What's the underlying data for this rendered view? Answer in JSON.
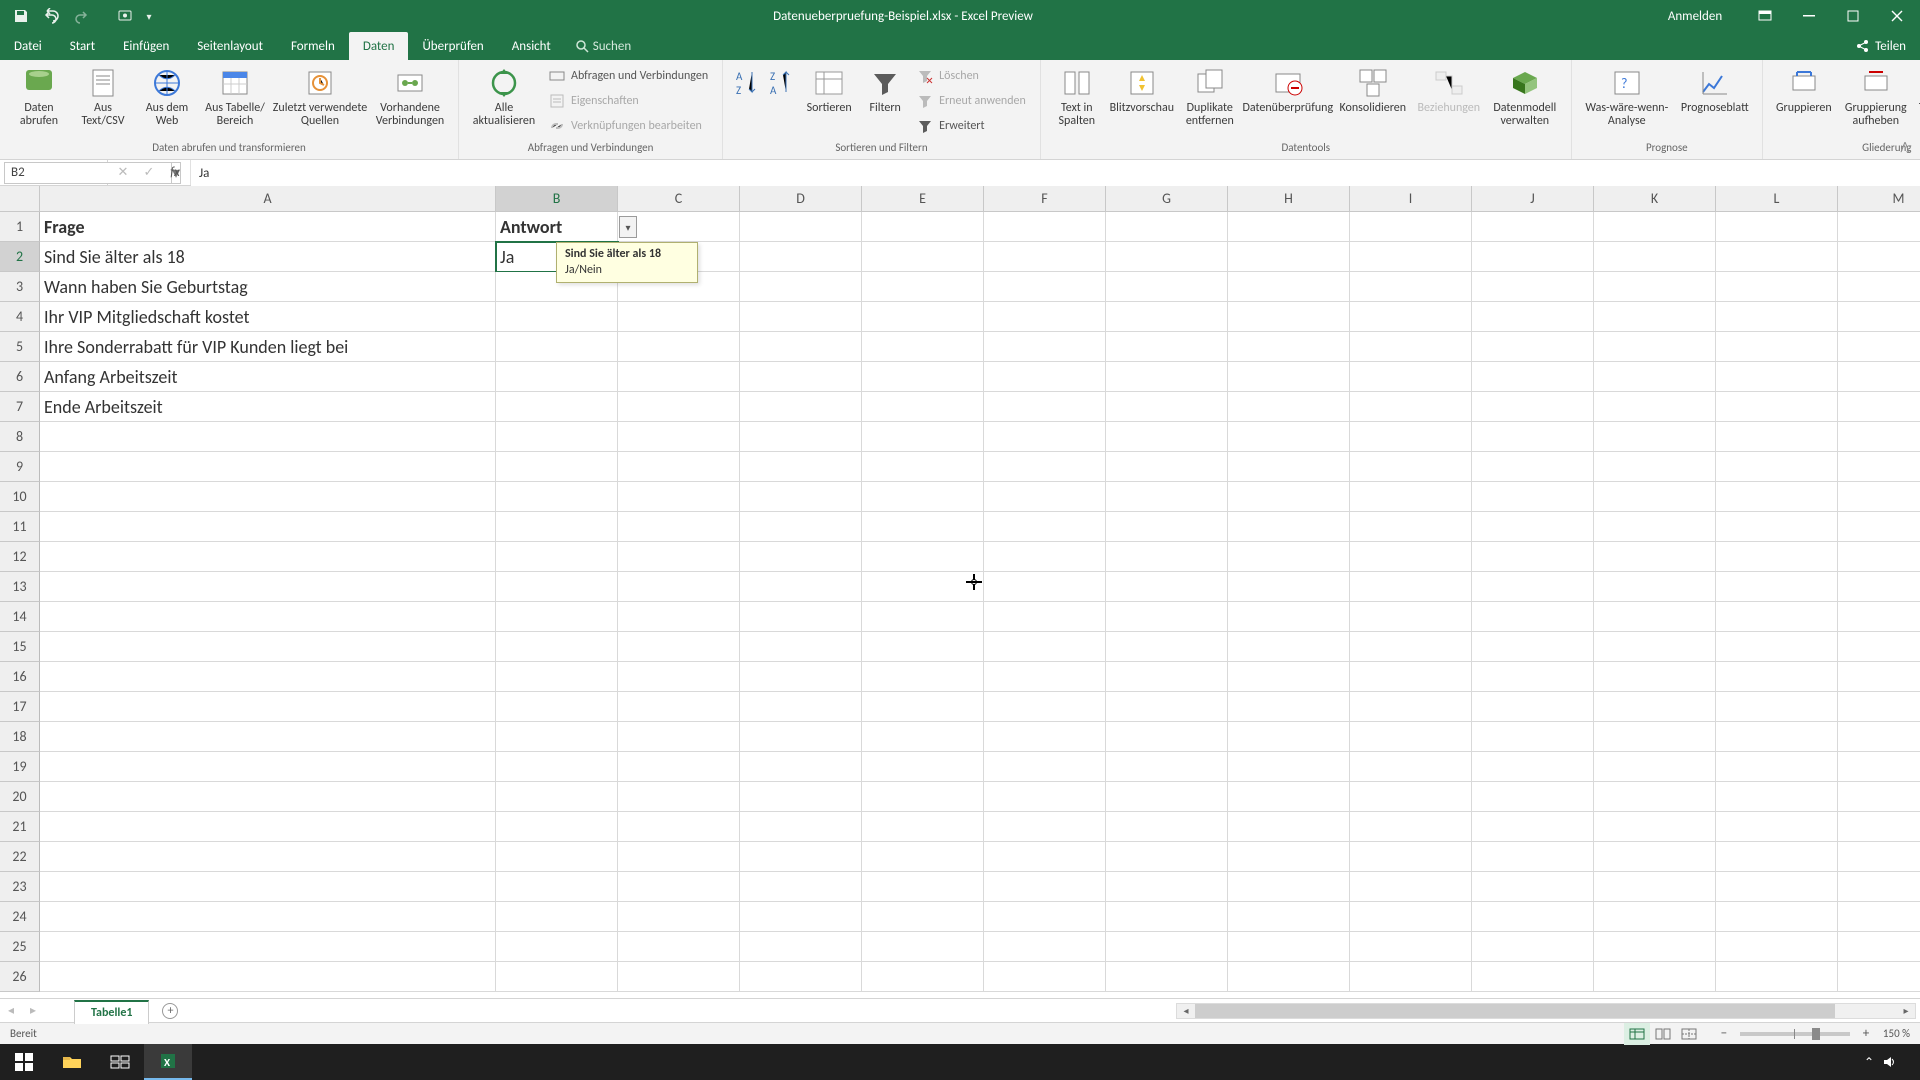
{
  "title_bar": {
    "document_title": "Datenueberpruefung-Beispiel.xlsx - Excel Preview",
    "signin": "Anmelden"
  },
  "ribbon_tabs": {
    "items": [
      "Datei",
      "Start",
      "Einfügen",
      "Seitenlayout",
      "Formeln",
      "Daten",
      "Überprüfen",
      "Ansicht"
    ],
    "active_index": 5,
    "search_placeholder": "Suchen",
    "share_label": "Teilen"
  },
  "ribbon_groups": {
    "get": {
      "label": "Daten abrufen und transformieren",
      "btn_get": "Daten\nabrufen",
      "btn_text": "Aus\nText/CSV",
      "btn_web": "Aus dem\nWeb",
      "btn_tr": "Aus Tabelle/\nBereich",
      "btn_recent": "Zuletzt verwendete\nQuellen",
      "btn_exist": "Vorhandene\nVerbindungen"
    },
    "conn": {
      "label": "Abfragen und Verbindungen",
      "btn_refresh": "Alle\naktualisieren",
      "s1": "Abfragen und Verbindungen",
      "s2": "Eigenschaften",
      "s3": "Verknüpfungen bearbeiten"
    },
    "sort": {
      "label": "Sortieren und Filtern",
      "btn_sort": "Sortieren",
      "btn_filter": "Filtern",
      "s1": "Löschen",
      "s2": "Erneut anwenden",
      "s3": "Erweitert"
    },
    "tools": {
      "label": "Datentools",
      "b1": "Text in\nSpalten",
      "b2": "Blitzvorschau",
      "b3": "Duplikate\nentfernen",
      "b4": "Datenüberprüfung",
      "b5": "Konsolidieren",
      "b6": "Beziehungen",
      "b7": "Datenmodell\nverwalten"
    },
    "forecast": {
      "label": "Prognose",
      "b1": "Was-wäre-wenn-\nAnalyse",
      "b2": "Prognoseblatt"
    },
    "outline": {
      "label": "Gliederung",
      "b1": "Gruppieren",
      "b2": "Gruppierung\naufheben",
      "b3": "Teilergebnis"
    }
  },
  "formula_bar": {
    "namebox": "B2",
    "content": "Ja"
  },
  "grid": {
    "columns": [
      "A",
      "B",
      "C",
      "D",
      "E",
      "F",
      "G",
      "H",
      "I",
      "J",
      "K",
      "L",
      "M"
    ],
    "last_row": 26,
    "selected": {
      "row": 2,
      "col": "B"
    },
    "rows": [
      {
        "n": 1,
        "A": "Frage",
        "B": "Antwort",
        "bold": true
      },
      {
        "n": 2,
        "A": "Sind Sie älter als 18",
        "B": "Ja"
      },
      {
        "n": 3,
        "A": "Wann haben Sie Geburtstag",
        "B": ""
      },
      {
        "n": 4,
        "A": "Ihr VIP Mitgliedschaft kostet",
        "B": ""
      },
      {
        "n": 5,
        "A": "Ihre Sonderrabatt für VIP Kunden liegt bei",
        "B": ""
      },
      {
        "n": 6,
        "A": "Anfang Arbeitszeit",
        "B": ""
      },
      {
        "n": 7,
        "A": "Ende Arbeitszeit",
        "B": ""
      }
    ]
  },
  "validation_tip": {
    "title": "Sind Sie älter als 18",
    "body": "Ja/Nein"
  },
  "sheet_tabs": {
    "active": "Tabelle1"
  },
  "status_bar": {
    "ready": "Bereit",
    "zoom": "150 %"
  }
}
